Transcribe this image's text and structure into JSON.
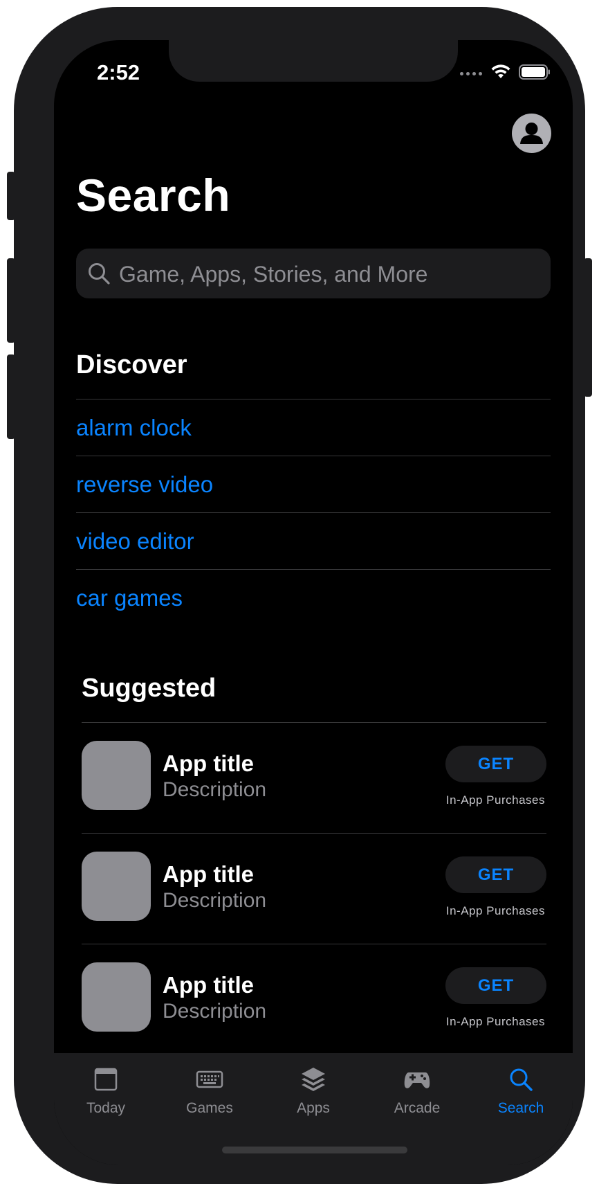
{
  "status_bar": {
    "time": "2:52"
  },
  "header": {
    "title": "Search"
  },
  "search": {
    "placeholder": "Game, Apps, Stories, and More"
  },
  "discover": {
    "title": "Discover",
    "items": [
      "alarm clock",
      "reverse video",
      "video editor",
      "car games"
    ]
  },
  "suggested": {
    "title": "Suggested",
    "apps": [
      {
        "title": "App title",
        "description": "Description",
        "button": "GET",
        "note": "In-App Purchases"
      },
      {
        "title": "App title",
        "description": "Description",
        "button": "GET",
        "note": "In-App Purchases"
      },
      {
        "title": "App title",
        "description": "Description",
        "button": "GET",
        "note": "In-App Purchases"
      }
    ]
  },
  "tab_bar": {
    "tabs": [
      {
        "label": "Today",
        "icon": "today-icon",
        "active": false
      },
      {
        "label": "Games",
        "icon": "games-icon",
        "active": false
      },
      {
        "label": "Apps",
        "icon": "apps-icon",
        "active": false
      },
      {
        "label": "Arcade",
        "icon": "arcade-icon",
        "active": false
      },
      {
        "label": "Search",
        "icon": "search-icon",
        "active": true
      }
    ]
  },
  "colors": {
    "accent": "#0a84ff",
    "background": "#000000",
    "secondary_text": "#8e8e93",
    "card": "#1c1c1e"
  }
}
